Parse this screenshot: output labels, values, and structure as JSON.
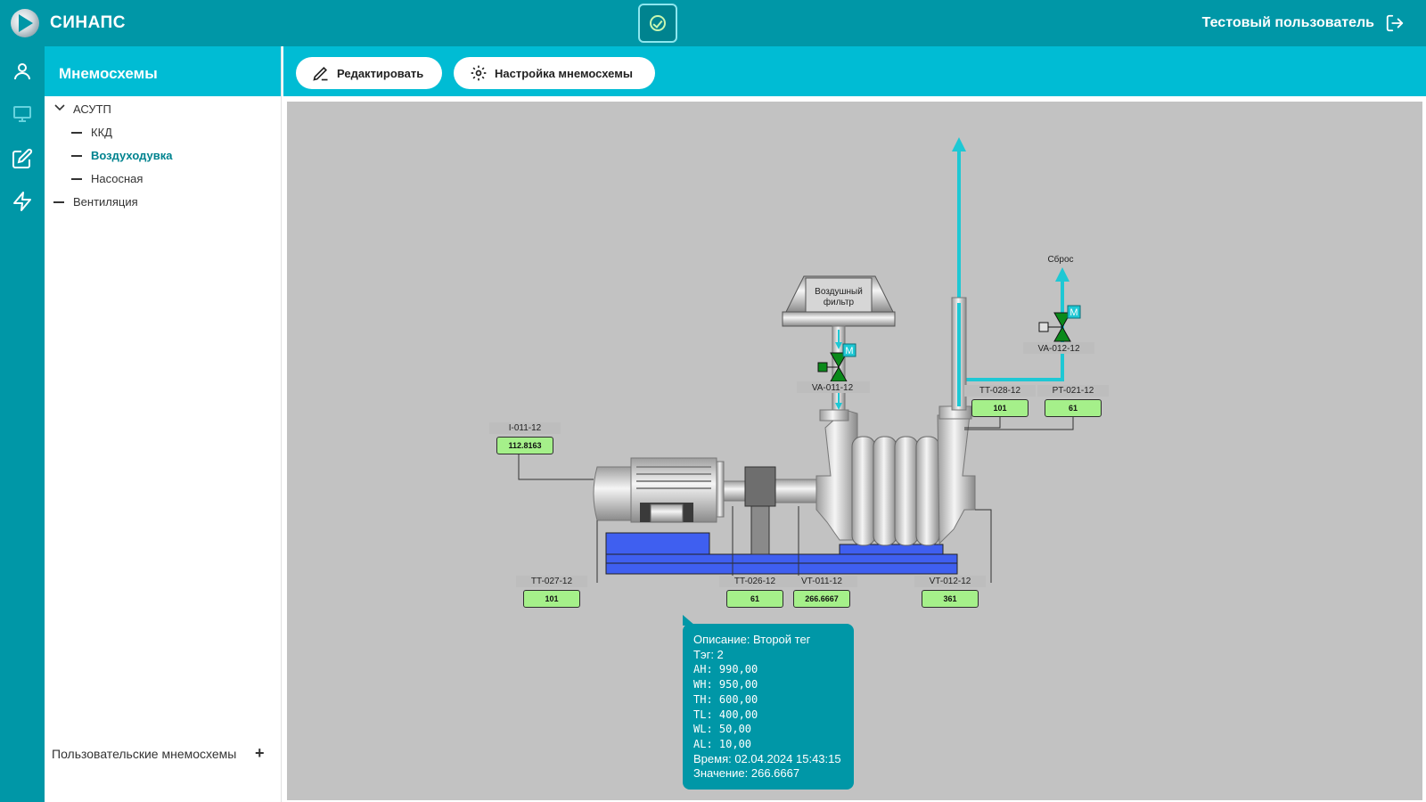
{
  "app": {
    "name": "СИНАПС",
    "user": "Тестовый пользователь"
  },
  "tree": {
    "title": "Мнемосхемы",
    "items": [
      {
        "label": "АСУТП"
      },
      {
        "label": "ККД"
      },
      {
        "label": "Воздуходувка"
      },
      {
        "label": "Насосная"
      },
      {
        "label": "Вентиляция"
      }
    ],
    "footer": "Пользовательские мнемосхемы"
  },
  "toolbar": {
    "edit": "Редактировать",
    "settings": "Настройка мнемосхемы"
  },
  "scheme": {
    "filter_label_1": "Воздушный",
    "filter_label_2": "фильтр",
    "reset_label": "Сброс",
    "valve_1": "VA-011-12",
    "valve_2": "VA-012-12",
    "motor_badge": "M",
    "tags": [
      {
        "name": "I-011-12",
        "value": "112.8163"
      },
      {
        "name": "TT-027-12",
        "value": "101"
      },
      {
        "name": "TT-026-12",
        "value": "61"
      },
      {
        "name": "VT-011-12",
        "value": "266.6667"
      },
      {
        "name": "VT-012-12",
        "value": "361"
      },
      {
        "name": "TT-028-12",
        "value": "101"
      },
      {
        "name": "PT-021-12",
        "value": "61"
      }
    ]
  },
  "tooltip": {
    "lines": [
      "Описание: Второй тег",
      "Тэг: 2",
      "AH: 990,00",
      "WH: 950,00",
      "TH: 600,00",
      "TL: 400,00",
      "WL: 50,00",
      "AL: 10,00",
      "Время: 02.04.2024 15:43:15",
      "Значение: 266.6667"
    ]
  },
  "colors": {
    "accent": "#00bcd4",
    "dark_accent": "#0097a7",
    "pipe": "#1ec8d4",
    "tag_fill": "#a5f08a",
    "base": "#3f5ff0"
  }
}
